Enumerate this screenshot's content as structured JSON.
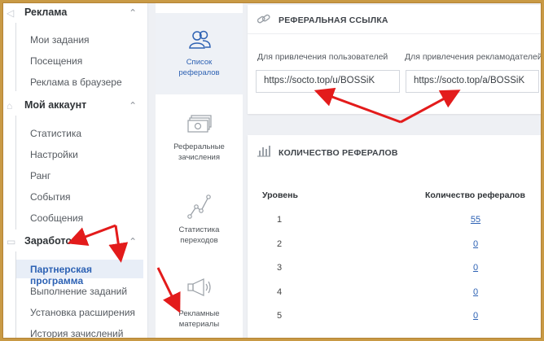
{
  "sidebar": {
    "sections": [
      {
        "title": "Реклама",
        "icon": "megaphone-icon"
      },
      {
        "title": "Мой аккаунт",
        "icon": "home-icon"
      },
      {
        "title": "Заработок",
        "icon": "wallet-icon"
      }
    ],
    "ads_items": [
      "Мои задания",
      "Посещения",
      "Реклама в браузере"
    ],
    "account_items": [
      "Статистика",
      "Настройки",
      "Ранг",
      "События",
      "Сообщения"
    ],
    "earn_items": [
      "Партнерская программа",
      "Выполнение заданий",
      "Установка расширения",
      "История зачислений"
    ]
  },
  "vmenu": {
    "items": [
      {
        "label1": "Список",
        "label2": "рефералов",
        "icon": "users-icon"
      },
      {
        "label1": "Реферальные",
        "label2": "зачисления",
        "icon": "money-icon"
      },
      {
        "label1": "Статистика",
        "label2": "переходов",
        "icon": "chart-line-icon"
      },
      {
        "label1": "Рекламные",
        "label2": "материалы",
        "icon": "megaphone-icon"
      }
    ]
  },
  "ref_link": {
    "title": "РЕФЕРАЛЬНАЯ ССЫЛКА",
    "user_label": "Для привлечения пользователей",
    "user_link": "https://socto.top/u/BOSSiK",
    "adv_label": "Для привлечения рекламодателей",
    "adv_link": "https://socto.top/a/BOSSiK"
  },
  "ref_count": {
    "title": "КОЛИЧЕСТВО РЕФЕРАЛОВ",
    "col_level": "Уровень",
    "col_count": "Количество рефералов",
    "rows": [
      {
        "level": "1",
        "count": "55"
      },
      {
        "level": "2",
        "count": "0"
      },
      {
        "level": "3",
        "count": "0"
      },
      {
        "level": "4",
        "count": "0"
      },
      {
        "level": "5",
        "count": "0"
      }
    ]
  },
  "colors": {
    "accent": "#2d62b4",
    "arrow": "#e31b1b",
    "border": "#c99a45"
  }
}
